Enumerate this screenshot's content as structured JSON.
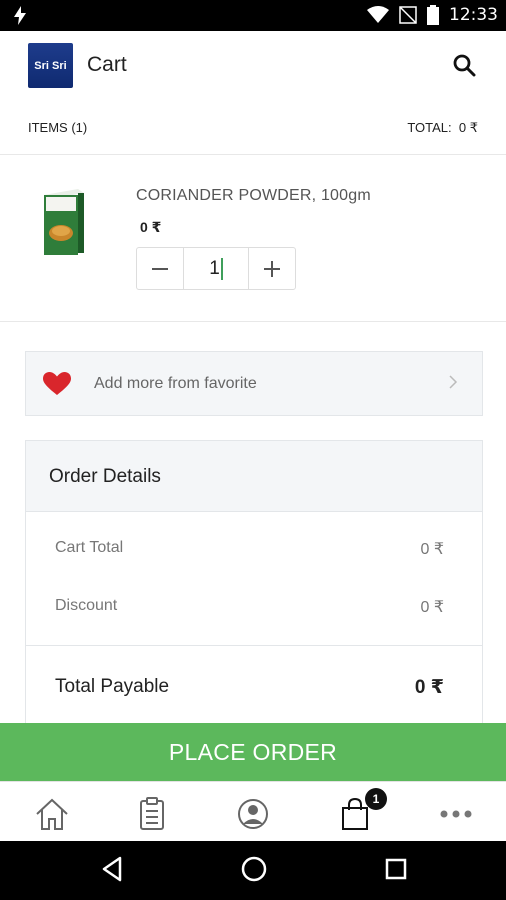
{
  "status_bar": {
    "time": "12:33"
  },
  "app_bar": {
    "logo_text": "Sri Sri",
    "title": "Cart"
  },
  "summary": {
    "items_label": "ITEMS (1)",
    "total_label": "TOTAL:",
    "total_value": "0 ₹"
  },
  "cart_items": [
    {
      "name": "CORIANDER POWDER, 100gm",
      "price": "0 ₹",
      "quantity": "1"
    }
  ],
  "favorites": {
    "label": "Add more from favorite"
  },
  "order_details": {
    "heading": "Order Details",
    "cart_total_label": "Cart Total",
    "cart_total_value": "0 ₹",
    "discount_label": "Discount",
    "discount_value": "0 ₹",
    "payable_label": "Total Payable",
    "payable_value": "0 ₹"
  },
  "actions": {
    "place_order": "PLACE ORDER"
  },
  "bottom_nav": {
    "items": [
      "home-icon",
      "orders-icon",
      "profile-icon",
      "cart-icon",
      "more-icon"
    ],
    "cart_badge": "1"
  },
  "colors": {
    "accent_green": "#5cb85c",
    "heart_red": "#d9262c",
    "logo_blue": "#1e3c8c"
  }
}
